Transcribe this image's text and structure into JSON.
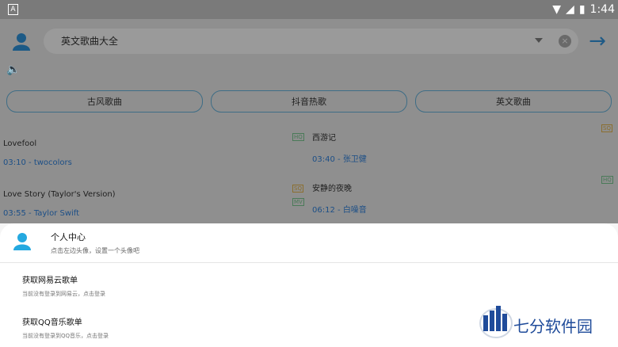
{
  "status_bar": {
    "app_icon": "A",
    "time": "1:44",
    "battery_level": "battery-icon"
  },
  "search": {
    "query": "英文歌曲大全"
  },
  "categories": [
    {
      "label": "古风歌曲"
    },
    {
      "label": "抖音热歌"
    },
    {
      "label": "英文歌曲"
    }
  ],
  "songs": {
    "left": [
      {
        "title": "Lovefool",
        "duration": "03:10",
        "artist": "twocolors"
      },
      {
        "title": "Love Story (Taylor's Version)",
        "duration": "03:55",
        "artist": "Taylor Swift"
      }
    ],
    "right": [
      {
        "title": "西游记",
        "duration": "03:40",
        "artist": "张卫健",
        "badge_left": "HQ",
        "badge_right": "SQ"
      },
      {
        "title": "安静的夜晚",
        "duration": "06:12",
        "artist": "白噪音",
        "badge_left": "SQ",
        "badge_left2": "MV",
        "badge_right": "HQ"
      }
    ]
  },
  "sheet": {
    "profile_title": "个人中心",
    "profile_sub": "点击左边头像，设置一个头像吧",
    "items": [
      {
        "title": "获取网易云歌单",
        "sub": "当前没有登录到网易云，点击登录"
      },
      {
        "title": "获取QQ音乐歌单",
        "sub": "当前没有登录到QQ音乐，点击登录"
      }
    ]
  },
  "watermark": {
    "text": "七分软件园"
  }
}
